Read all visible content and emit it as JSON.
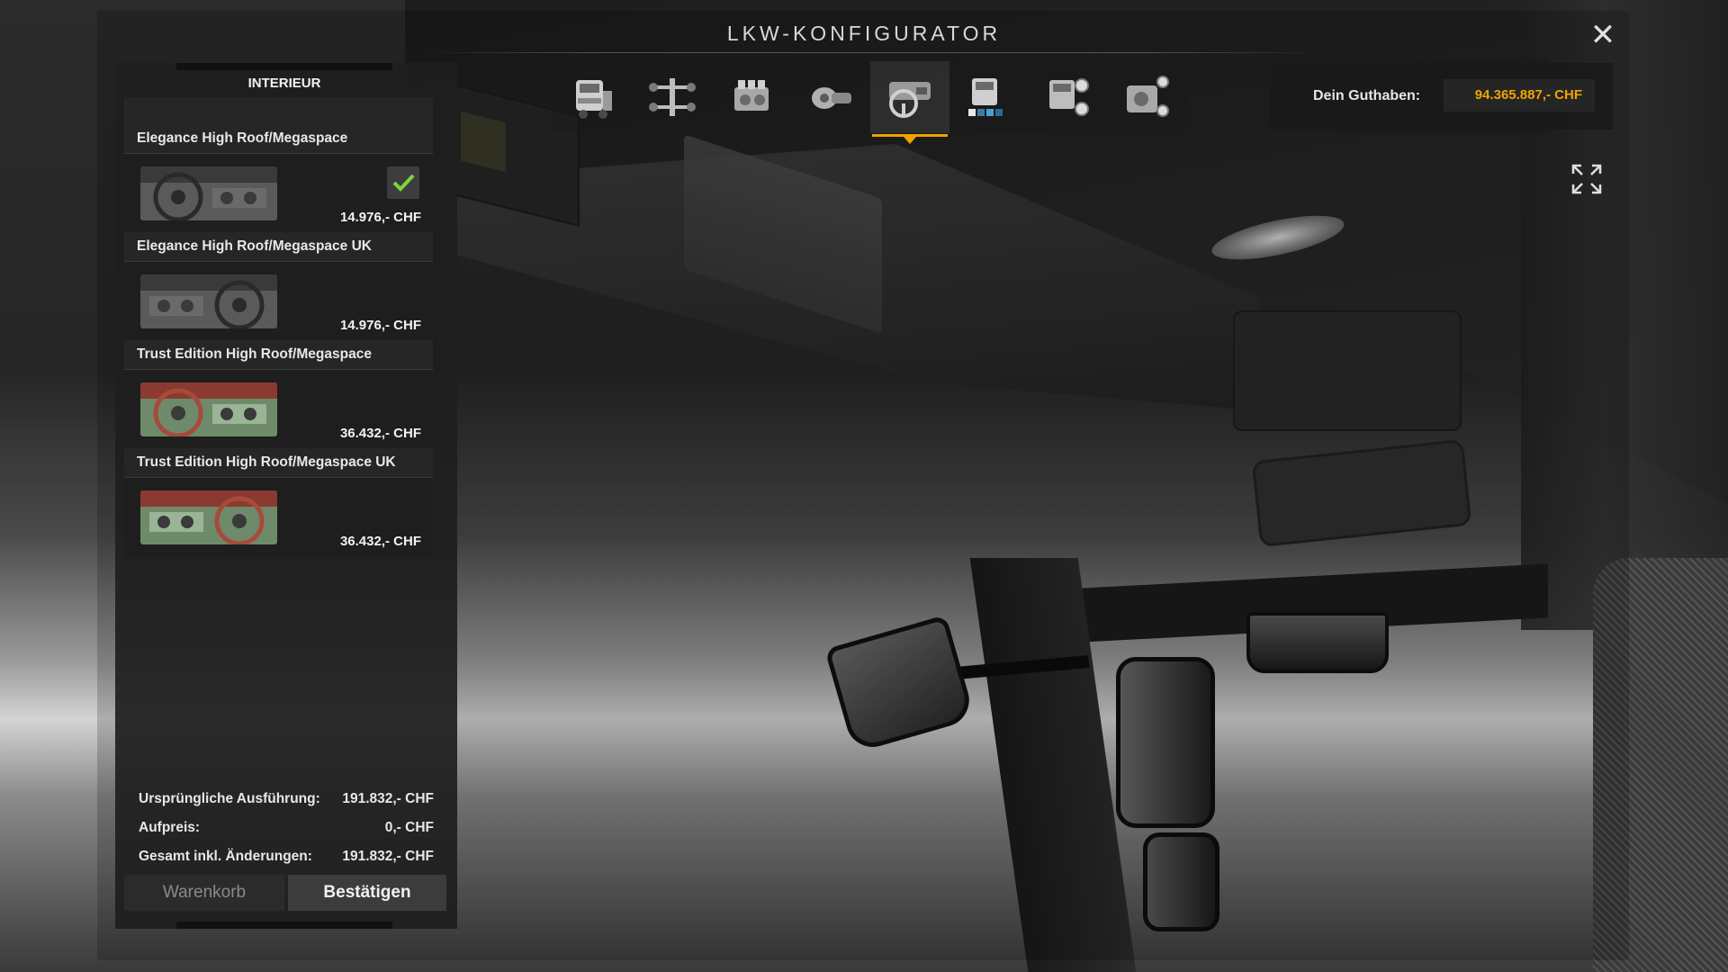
{
  "window": {
    "title": "LKW-KONFIGURATOR",
    "close_icon": "close-icon"
  },
  "toolbar": {
    "items": [
      {
        "name": "chassis-cab",
        "icon": "truck-cab-icon",
        "active": false
      },
      {
        "name": "chassis",
        "icon": "chassis-axles-icon",
        "active": false
      },
      {
        "name": "engine",
        "icon": "engine-icon",
        "active": false
      },
      {
        "name": "transmission",
        "icon": "transmission-icon",
        "active": false
      },
      {
        "name": "interior",
        "icon": "interior-steering-icon",
        "active": true
      },
      {
        "name": "paint",
        "icon": "truck-paint-icon",
        "active": false
      },
      {
        "name": "wheels",
        "icon": "truck-wheels-icon",
        "active": false
      },
      {
        "name": "accessories",
        "icon": "truck-accessories-icon",
        "active": false
      }
    ],
    "accent_color": "#f0a400"
  },
  "balance": {
    "label": "Dein Guthaben:",
    "value": "94.365.887,- CHF",
    "value_color": "#f0a400"
  },
  "panel": {
    "header": "INTERIEUR",
    "items": [
      {
        "title": "Elegance High Roof/Megaspace",
        "price": "14.976,- CHF",
        "selected": true,
        "variant": "grey-lhd"
      },
      {
        "title": "Elegance High Roof/Megaspace UK",
        "price": "14.976,- CHF",
        "selected": false,
        "variant": "grey-rhd"
      },
      {
        "title": "Trust Edition High Roof/Megaspace",
        "price": "36.432,- CHF",
        "selected": false,
        "variant": "green-red-lhd"
      },
      {
        "title": "Trust Edition High Roof/Megaspace UK",
        "price": "36.432,- CHF",
        "selected": false,
        "variant": "green-red-rhd"
      }
    ],
    "summary": [
      {
        "label": "Ursprüngliche Ausführung:",
        "value": "191.832,- CHF"
      },
      {
        "label": "Aufpreis:",
        "value": "0,- CHF"
      },
      {
        "label": "Gesamt inkl. Änderungen:",
        "value": "191.832,- CHF"
      }
    ],
    "buttons": {
      "cart": "Warenkorb",
      "confirm": "Bestätigen"
    }
  },
  "fullscreen_icon": "fullscreen-expand-icon"
}
